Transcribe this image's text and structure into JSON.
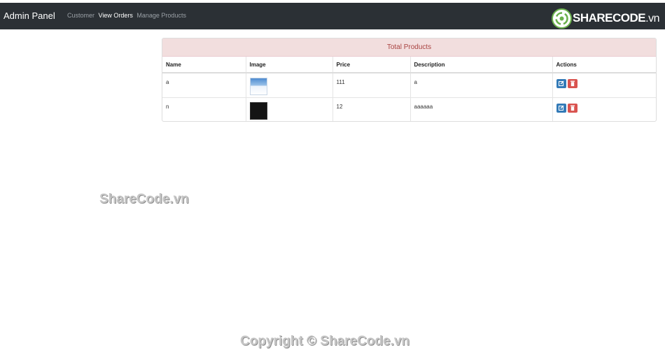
{
  "navbar": {
    "brand": "Admin Panel",
    "links": [
      {
        "label": "Customer",
        "active": false
      },
      {
        "label": "View Orders",
        "active": true
      },
      {
        "label": "Manage Products",
        "active": false
      }
    ]
  },
  "logo": {
    "text_main": "SHARECODE",
    "text_suffix": ".vn"
  },
  "panel": {
    "heading": "Total Products",
    "columns": [
      "Name",
      "Image",
      "Price",
      "Description",
      "Actions"
    ],
    "rows": [
      {
        "name": "a",
        "image": "thumbnail-light",
        "price": "111",
        "description": "a"
      },
      {
        "name": "n",
        "image": "thumbnail-dark",
        "price": "12",
        "description": "aaaaaa"
      }
    ]
  },
  "actions_icons": {
    "edit": "edit-icon",
    "delete": "trash-icon"
  },
  "colors": {
    "navbar_bg": "#2b3035",
    "panel_heading_bg": "#f2dede",
    "panel_heading_text": "#a94442",
    "edit_button": "#337ab7",
    "delete_button": "#d9534f"
  },
  "watermarks": [
    "ShareCode.vn",
    "Copyright © ShareCode.vn"
  ]
}
